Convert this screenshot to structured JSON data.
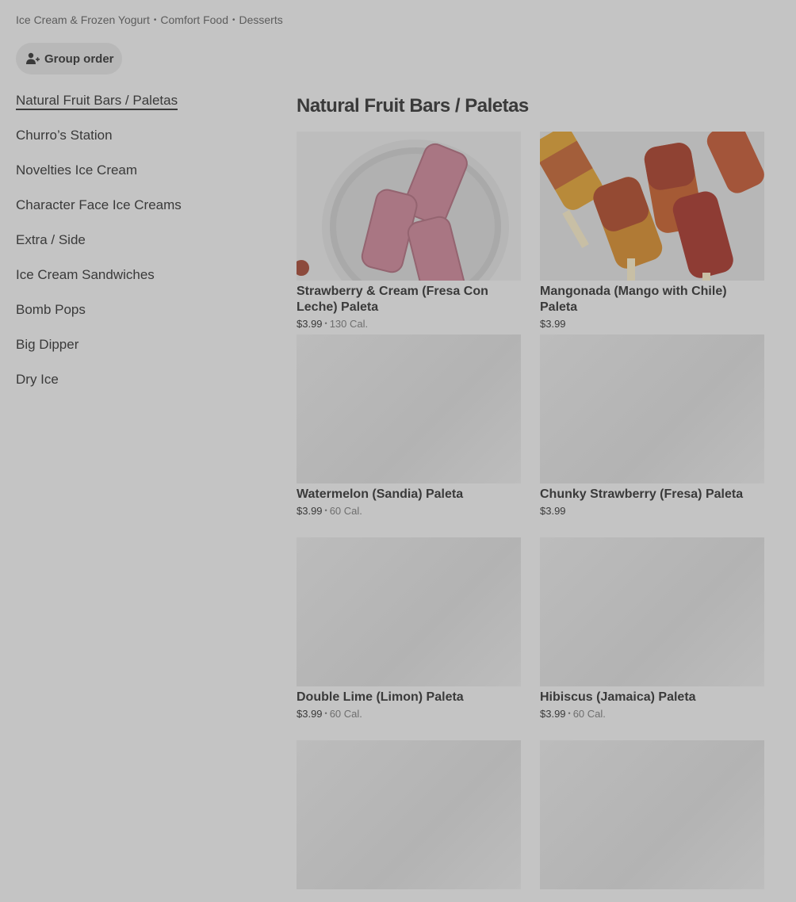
{
  "breadcrumb": [
    "Ice Cream & Frozen Yogurt",
    "Comfort Food",
    "Desserts"
  ],
  "group_order": {
    "label": "Group order",
    "icon": "person-add-icon"
  },
  "sidebar": {
    "items": [
      {
        "label": "Natural Fruit Bars / Paletas",
        "active": true
      },
      {
        "label": "Churro’s Station"
      },
      {
        "label": "Novelties Ice Cream"
      },
      {
        "label": "Character Face Ice Creams"
      },
      {
        "label": "Extra / Side"
      },
      {
        "label": "Ice Cream Sandwiches"
      },
      {
        "label": "Bomb Pops"
      },
      {
        "label": "Big Dipper"
      },
      {
        "label": "Dry Ice"
      }
    ]
  },
  "section": {
    "title": "Natural Fruit Bars / Paletas",
    "items": [
      {
        "name": "Strawberry & Cream (Fresa Con Leche) Paleta",
        "price": "$3.99",
        "cal": "130 Cal.",
        "image": "strawberry-cream-paletas-photo"
      },
      {
        "name": "Mangonada (Mango with Chile) Paleta",
        "price": "$3.99",
        "cal": "",
        "image": "mangonada-paletas-photo"
      },
      {
        "name": "Watermelon (Sandia) Paleta",
        "price": "$3.99",
        "cal": "60 Cal.",
        "image": ""
      },
      {
        "name": "Chunky Strawberry (Fresa) Paleta",
        "price": "$3.99",
        "cal": "",
        "image": ""
      },
      {
        "name": "Double Lime (Limon) Paleta",
        "price": "$3.99",
        "cal": "60 Cal.",
        "image": ""
      },
      {
        "name": "Hibiscus (Jamaica) Paleta",
        "price": "$3.99",
        "cal": "60 Cal.",
        "image": ""
      },
      {
        "name": "",
        "price": "",
        "cal": "",
        "image": ""
      },
      {
        "name": "",
        "price": "",
        "cal": "",
        "image": ""
      }
    ]
  }
}
